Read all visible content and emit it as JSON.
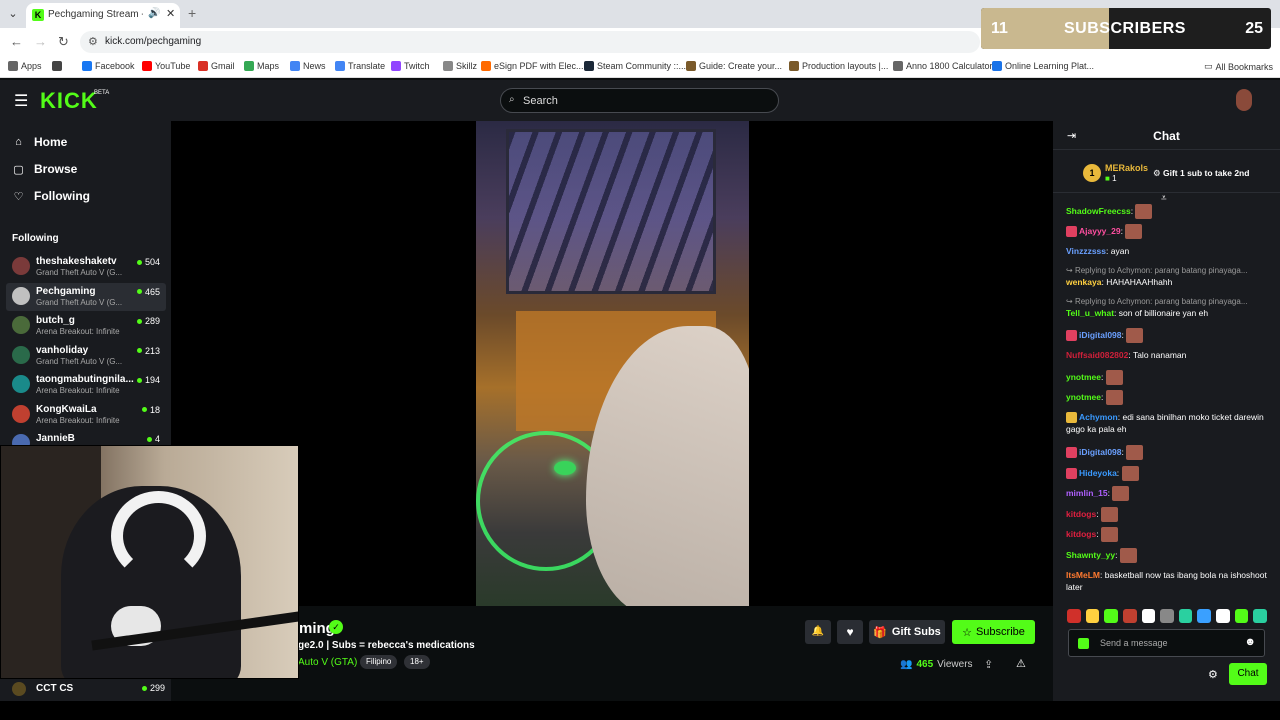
{
  "browser": {
    "tab_title": "Pechgaming Stream - Watch",
    "url": "kick.com/pechgaming",
    "bookmarks": [
      {
        "label": "Apps",
        "icon": "apps-icon",
        "color": "#666666"
      },
      {
        "label": "",
        "icon": "grid-icon",
        "color": "#444444"
      },
      {
        "label": "Facebook",
        "icon": "facebook-icon",
        "color": "#1877f2"
      },
      {
        "label": "YouTube",
        "icon": "youtube-icon",
        "color": "#ff0000"
      },
      {
        "label": "Gmail",
        "icon": "gmail-icon",
        "color": "#d93025"
      },
      {
        "label": "Maps",
        "icon": "maps-icon",
        "color": "#34a853"
      },
      {
        "label": "News",
        "icon": "news-icon",
        "color": "#4285f4"
      },
      {
        "label": "Translate",
        "icon": "translate-icon",
        "color": "#4285f4"
      },
      {
        "label": "Twitch",
        "icon": "twitch-icon",
        "color": "#9146ff"
      },
      {
        "label": "Skillz",
        "icon": "skillz-icon",
        "color": "#888888"
      },
      {
        "label": "eSign PDF with Elec...",
        "icon": "esign-icon",
        "color": "#ff6a00"
      },
      {
        "label": "Steam Community ::...",
        "icon": "steam-icon",
        "color": "#1b2838"
      },
      {
        "label": "Guide: Create your...",
        "icon": "guide-icon",
        "color": "#7a5a2a"
      },
      {
        "label": "Production layouts |...",
        "icon": "layouts-icon",
        "color": "#7a5a2a"
      },
      {
        "label": "Anno 1800 Calculator",
        "icon": "anno-icon",
        "color": "#666666"
      },
      {
        "label": "Online Learning Plat...",
        "icon": "learning-icon",
        "color": "#1a73e8"
      }
    ],
    "all_bookmarks": "All Bookmarks"
  },
  "overlay": {
    "sub_count": "11",
    "label": "SUBSCRIBERS",
    "goal": "25",
    "progress": 0.44
  },
  "header": {
    "logo": "KICK",
    "beta": "BETA",
    "search_placeholder": "Search"
  },
  "sidebar": {
    "nav": [
      {
        "label": "Home",
        "icon": "home-icon"
      },
      {
        "label": "Browse",
        "icon": "browse-icon"
      },
      {
        "label": "Following",
        "icon": "heart-icon"
      }
    ],
    "following_heading": "Following",
    "channels": [
      {
        "name": "theshakeshaketv",
        "game": "Grand Theft Auto V (G...",
        "viewers": "504",
        "color": "#7a3a3a"
      },
      {
        "name": "Pechgaming",
        "game": "Grand Theft Auto V (G...",
        "viewers": "465",
        "color": "#c0c0c0",
        "active": true
      },
      {
        "name": "butch_g",
        "game": "Arena Breakout: Infinite",
        "viewers": "289",
        "color": "#4a6a3a"
      },
      {
        "name": "vanholiday",
        "game": "Grand Theft Auto V (G...",
        "viewers": "213",
        "color": "#2a6a4a"
      },
      {
        "name": "taongmabutingnila...",
        "game": "Arena Breakout: Infinite",
        "viewers": "194",
        "color": "#1a8a8a"
      },
      {
        "name": "KongKwaiLa",
        "game": "Arena Breakout: Infinite",
        "viewers": "18",
        "color": "#c04030"
      },
      {
        "name": "JannieB",
        "game": "",
        "viewers": "4",
        "color": "#4a6ab0"
      }
    ],
    "bottom_channel": {
      "name": "CCT CS",
      "viewers": "299"
    }
  },
  "stream": {
    "channel_name": "ming",
    "title": "ge2.0 | Subs = rebecca's medications",
    "category": "Auto V (GTA)",
    "tags": [
      "Filipino",
      "18+"
    ],
    "gift_subs_label": "Gift Subs",
    "subscribe_label": "Subscribe",
    "viewers": "465",
    "viewers_label": "Viewers"
  },
  "chat": {
    "title": "Chat",
    "pinned": {
      "rank": "1",
      "name": "MERakols",
      "gifts": "1",
      "promo": "Gift 1 sub to take 2nd"
    },
    "messages": [
      {
        "type": "msg",
        "user": "ShadowFreecss",
        "color": "#53fc18",
        "text": "",
        "emote": true
      },
      {
        "type": "msg",
        "user": "Ajayyy_29",
        "color": "#ff4fa0",
        "text": "",
        "emote": true,
        "badge": "#e04060"
      },
      {
        "type": "msg",
        "user": "Vinzzzsss",
        "color": "#6aa0ff",
        "text": "ayan"
      },
      {
        "type": "reply",
        "text": "Replying to Achymon: parang batang pinayaga..."
      },
      {
        "type": "msg",
        "user": "wenkaya",
        "color": "#ffd040",
        "text": "HAHAHAAHhahh"
      },
      {
        "type": "reply",
        "text": "Replying to Achymon: parang batang pinayaga..."
      },
      {
        "type": "msg",
        "user": "Tell_u_what",
        "color": "#53fc18",
        "text": "son of billionaire yan eh"
      },
      {
        "type": "msg",
        "user": "iDigital098",
        "color": "#6aa0ff",
        "text": "",
        "emote": true,
        "badge": "#e04060"
      },
      {
        "type": "msg",
        "user": "Nuffsaid082802",
        "color": "#d0203a",
        "text": "Talo nanaman"
      },
      {
        "type": "msg",
        "user": "ynotmee",
        "color": "#53fc18",
        "text": "",
        "emote": true
      },
      {
        "type": "msg",
        "user": "ynotmee",
        "color": "#53fc18",
        "text": "",
        "emote": true
      },
      {
        "type": "msg",
        "user": "Achymon",
        "color": "#3a9aff",
        "text": "edi sana binilhan moko ticket darewin gago ka pala eh",
        "badge": "#e9b93b"
      },
      {
        "type": "msg",
        "user": "iDigital098",
        "color": "#6aa0ff",
        "text": "",
        "emote": true,
        "badge": "#e04060"
      },
      {
        "type": "msg",
        "user": "Hideyoka",
        "color": "#3a9aff",
        "text": "",
        "emote": true,
        "badge": "#e04060"
      },
      {
        "type": "msg",
        "user": "mimlin_15",
        "color": "#b060ff",
        "text": "",
        "emote": true
      },
      {
        "type": "msg",
        "user": "kitdogs",
        "color": "#e02040",
        "text": "",
        "emote": true
      },
      {
        "type": "msg",
        "user": "kitdogs",
        "color": "#e02040",
        "text": "",
        "emote": true
      },
      {
        "type": "msg",
        "user": "Shawnty_yy",
        "color": "#53fc18",
        "text": "",
        "emote": true
      },
      {
        "type": "msg",
        "user": "ItsMeLM",
        "color": "#ff7a30",
        "text": "basketball now tas ibang bola na ishoshoot later"
      }
    ],
    "quick_emotes": [
      "#d0302a",
      "#ffd040",
      "#53fc18",
      "#c04030",
      "#ffffff",
      "#888888",
      "#2ad0a0",
      "#3aa0ff",
      "#ffffff",
      "#53fc18",
      "#2ad0a0"
    ],
    "input_placeholder": "Send a message",
    "send_label": "Chat"
  }
}
